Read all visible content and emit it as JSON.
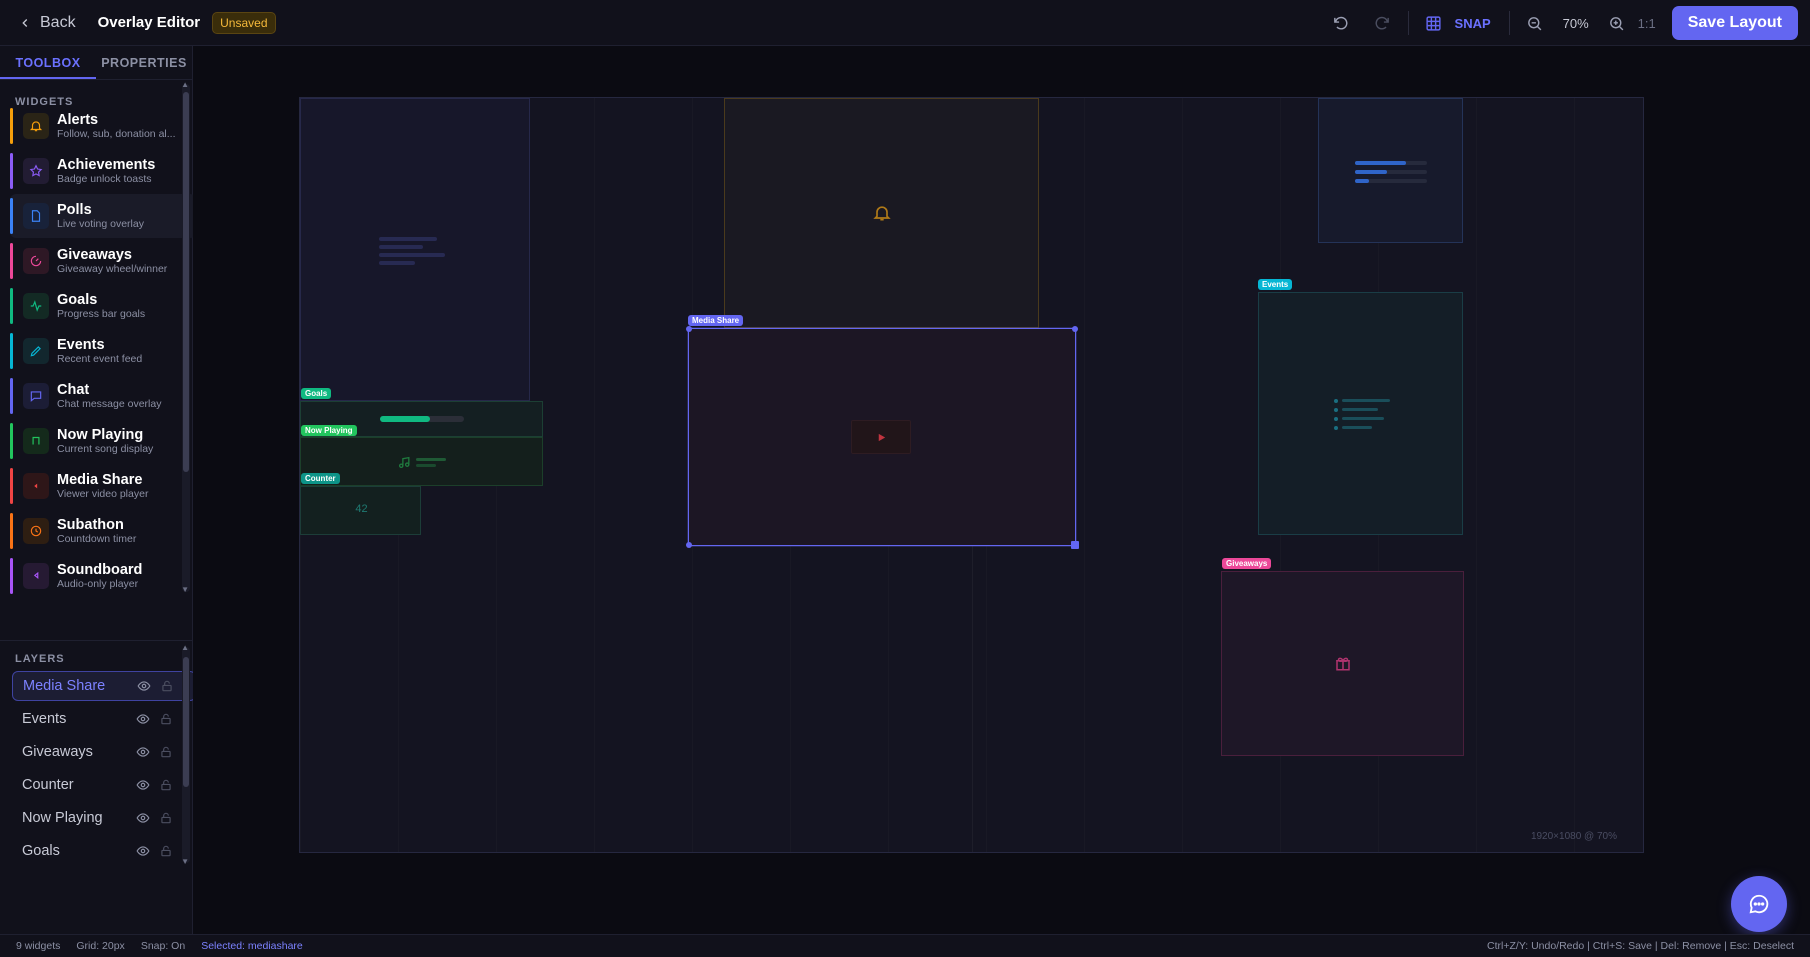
{
  "header": {
    "back_label": "Back",
    "title": "Overlay Editor",
    "status_badge": "Unsaved",
    "snap_label": "SNAP",
    "zoom_level": "70%",
    "ratio_label": "1:1",
    "save_label": "Save Layout"
  },
  "sidebar": {
    "tabs": [
      {
        "label": "TOOLBOX",
        "active": true
      },
      {
        "label": "PROPERTIES",
        "active": false
      }
    ],
    "widgets_title": "WIDGETS",
    "widgets": [
      {
        "name": "Alerts",
        "desc": "Follow, sub, donation al...",
        "color": "#f59e0b",
        "icon": "bell-icon"
      },
      {
        "name": "Achievements",
        "desc": "Badge unlock toasts",
        "color": "#8b5cf6",
        "icon": "star-icon"
      },
      {
        "name": "Polls",
        "desc": "Live voting overlay",
        "color": "#3b82f6",
        "icon": "document-icon"
      },
      {
        "name": "Giveaways",
        "desc": "Giveaway wheel/winner",
        "color": "#ec4899",
        "icon": "spinner-icon"
      },
      {
        "name": "Goals",
        "desc": "Progress bar goals",
        "color": "#10b981",
        "icon": "activity-icon"
      },
      {
        "name": "Events",
        "desc": "Recent event feed",
        "color": "#06b6d4",
        "icon": "pencil-icon"
      },
      {
        "name": "Chat",
        "desc": "Chat message overlay",
        "color": "#6366f1",
        "icon": "chat-icon"
      },
      {
        "name": "Now Playing",
        "desc": "Current song display",
        "color": "#22c55e",
        "icon": "music-icon"
      },
      {
        "name": "Media Share",
        "desc": "Viewer video player",
        "color": "#ef4444",
        "icon": "play-icon"
      },
      {
        "name": "Subathon",
        "desc": "Countdown timer",
        "color": "#f97316",
        "icon": "clock-icon"
      },
      {
        "name": "Soundboard",
        "desc": "Audio-only player",
        "color": "#a855f7",
        "icon": "speaker-icon"
      }
    ],
    "layers_title": "LAYERS",
    "layers": [
      {
        "name": "Media Share",
        "active": true
      },
      {
        "name": "Events",
        "active": false
      },
      {
        "name": "Giveaways",
        "active": false
      },
      {
        "name": "Counter",
        "active": false
      },
      {
        "name": "Now Playing",
        "active": false
      },
      {
        "name": "Goals",
        "active": false
      }
    ]
  },
  "canvas": {
    "labels": {
      "goals": "Goals",
      "now_playing": "Now Playing",
      "counter": "Counter",
      "media_share": "Media Share",
      "events": "Events",
      "giveaways": "Giveaways"
    },
    "counter_value": "42",
    "goal_progress": 0.6,
    "info": "1920×1080 @ 70%",
    "colors": {
      "accent": "#6366f1",
      "goals": "#10b981",
      "now_playing": "#22c55e",
      "counter": "#0d9488",
      "events": "#06b6d4",
      "giveaways": "#ec4899",
      "alerts": "#f59e0b",
      "polls": "#3b82f6",
      "media_share": "#ef4444"
    }
  },
  "statusbar": {
    "widgets_count": "9 widgets",
    "grid": "Grid: 20px",
    "snap": "Snap: On",
    "selected": "Selected: mediashare",
    "shortcuts": "Ctrl+Z/Y: Undo/Redo | Ctrl+S: Save | Del: Remove | Esc: Deselect"
  }
}
